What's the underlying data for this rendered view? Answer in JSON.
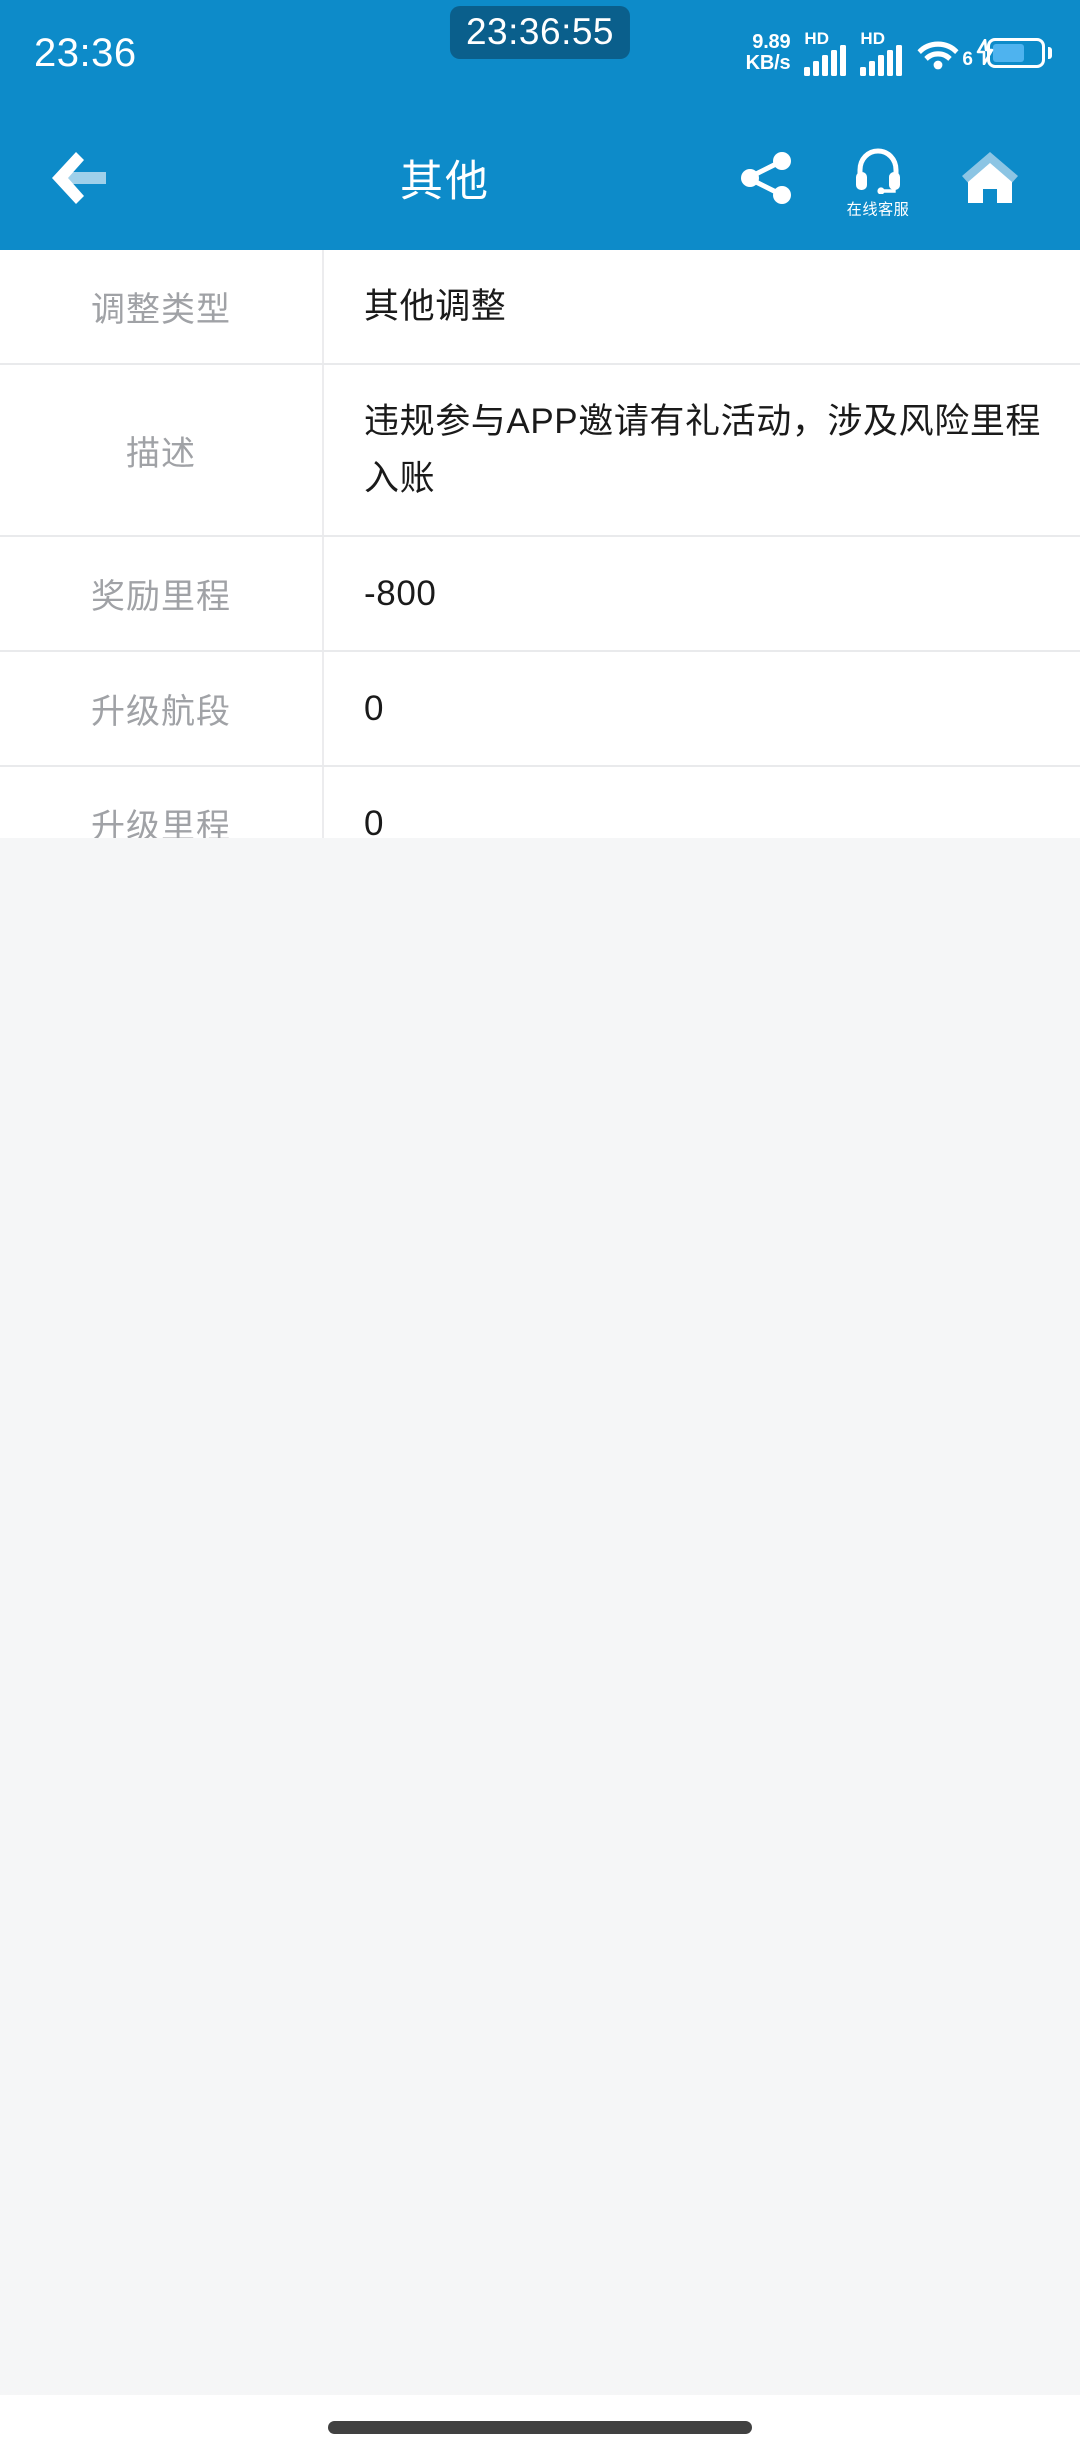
{
  "status_bar": {
    "clock": "23:36",
    "overlay_time": "23:36:55",
    "net_speed_value": "9.89",
    "net_speed_unit": "KB/s",
    "sim1_tag": "HD",
    "sim2_tag": "HD",
    "wifi_generation": "6",
    "battery_icon": "battery-charging-icon"
  },
  "nav": {
    "back_icon": "back-arrow-icon",
    "title": "其他",
    "share_icon": "share-icon",
    "customer_service_icon": "headset-icon",
    "customer_service_label": "在线客服",
    "home_icon": "home-icon"
  },
  "detail": {
    "rows": [
      {
        "label": "调整类型",
        "value": "其他调整"
      },
      {
        "label": "描述",
        "value": "违规参与APP邀请有礼活动，涉及风险里程入账"
      },
      {
        "label": "奖励里程",
        "value": "-800"
      },
      {
        "label": "升级航段",
        "value": "0"
      },
      {
        "label": "升级里程",
        "value": "0"
      }
    ]
  },
  "colors": {
    "brand_blue": "#0d8bc9",
    "badge_blue": "#0a5f8c",
    "accent_light_blue": "#4eb3ef",
    "page_background": "#f5f6f7",
    "label_gray": "#a0a2a6",
    "value_black": "#1a1a1a",
    "divider": "#e9eaec",
    "gesture_bar": "#414141"
  }
}
